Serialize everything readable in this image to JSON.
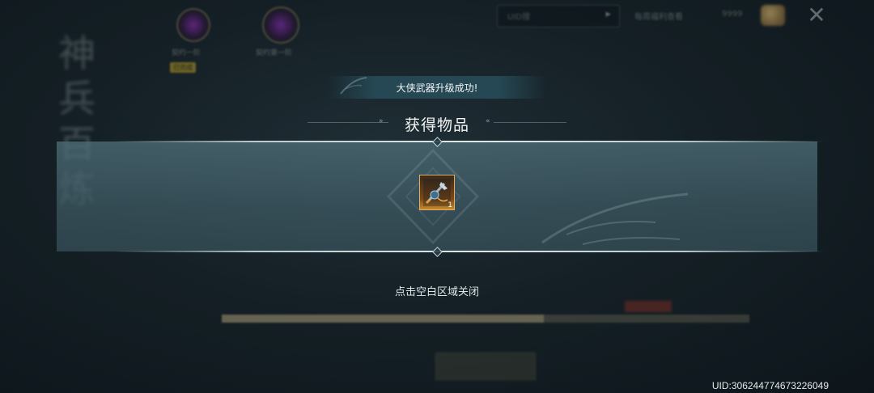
{
  "background": {
    "title_chars": [
      "神",
      "兵",
      "百",
      "炼"
    ],
    "search_placeholder": "UID搜",
    "hint_text": "每周福利查看",
    "coin_text": "9999",
    "slot_labels": [
      "契约一阶",
      "契约第一阶"
    ],
    "slot_badge": "已完成",
    "progress_fraction": 0.61
  },
  "popup": {
    "banner_text": "大侠武器升级成功!",
    "title": "获得物品",
    "items": [
      {
        "icon": "weapon-icon",
        "count": "1"
      }
    ],
    "close_hint": "点击空白区域关闭"
  },
  "footer": {
    "uid": "UID:3062447746732260​49"
  },
  "colors": {
    "banner_bg": "#264a56",
    "panel_bg": "#50707a",
    "item_border": "#e0b060"
  }
}
